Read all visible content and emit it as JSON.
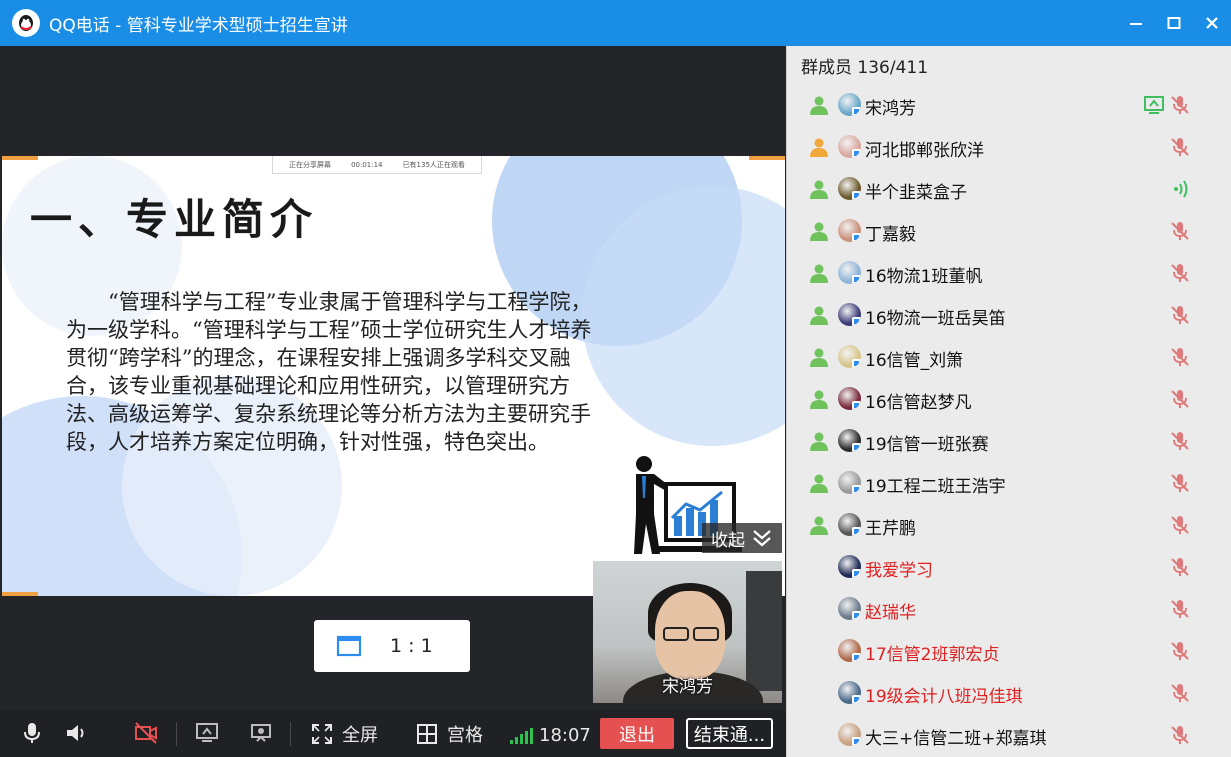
{
  "window": {
    "title": "QQ电话 - 管科专业学术型硕士招生宣讲"
  },
  "slide": {
    "share_bar": [
      "正在分享屏幕",
      "00:01:14",
      "已有135人正在观看"
    ],
    "title": "一、专业简介",
    "body": "“管理科学与工程”专业隶属于管理科学与工程学院，为一级学科。“管理科学与工程”硕士学位研究生人才培养贯彻“跨学科”的理念，在课程安排上强调多学科交叉融合，该专业重视基础理论和应用性研究，以管理研究方法、高级运筹学、复杂系统理论等分析方法为主要研究手段，人才培养方案定位明确，针对性强，特色突出。"
  },
  "collapse_label": "收起",
  "ratio_label": "1 : 1",
  "camera": {
    "name": "宋鸿芳"
  },
  "toolbar": {
    "fullscreen_label": "全屏",
    "grid_label": "宫格",
    "time": "18:07",
    "exit_label": "退出",
    "end_label": "结束通..."
  },
  "members": {
    "header": "群成员 136/411",
    "items": [
      {
        "name": "宋鸿芳",
        "role": "member",
        "status": "muted",
        "sharing": true,
        "red": false,
        "avatar": "#6aa8c8"
      },
      {
        "name": "河北邯郸张欣洋",
        "role": "admin",
        "status": "muted",
        "sharing": false,
        "red": false,
        "avatar": "#d9a7a0"
      },
      {
        "name": "半个韭菜盒子",
        "role": "member",
        "status": "speaking",
        "sharing": false,
        "red": false,
        "avatar": "#6b5a2a"
      },
      {
        "name": "丁嘉毅",
        "role": "member",
        "status": "muted",
        "sharing": false,
        "red": false,
        "avatar": "#c9907a"
      },
      {
        "name": "16物流1班董帆",
        "role": "member",
        "status": "muted",
        "sharing": false,
        "red": false,
        "avatar": "#8fb4d9"
      },
      {
        "name": "16物流一班岳昊笛",
        "role": "member",
        "status": "muted",
        "sharing": false,
        "red": false,
        "avatar": "#3c3c7a"
      },
      {
        "name": "16信管_刘箫",
        "role": "member",
        "status": "muted",
        "sharing": false,
        "red": false,
        "avatar": "#d8c58a"
      },
      {
        "name": "16信管赵梦凡",
        "role": "member",
        "status": "muted",
        "sharing": false,
        "red": false,
        "avatar": "#7a2a3a"
      },
      {
        "name": "19信管一班张赛",
        "role": "member",
        "status": "muted",
        "sharing": false,
        "red": false,
        "avatar": "#2c2c2c"
      },
      {
        "name": "19工程二班王浩宇",
        "role": "member",
        "status": "muted",
        "sharing": false,
        "red": false,
        "avatar": "#9a9a9a"
      },
      {
        "name": "王芹鹏",
        "role": "member",
        "status": "muted",
        "sharing": false,
        "red": false,
        "avatar": "#555555"
      },
      {
        "name": "我爱学习",
        "role": "none",
        "status": "muted",
        "sharing": false,
        "red": true,
        "avatar": "#1d2a55"
      },
      {
        "name": "赵瑞华",
        "role": "none",
        "status": "muted",
        "sharing": false,
        "red": true,
        "avatar": "#6a7a8a"
      },
      {
        "name": "17信管2班郭宏贞",
        "role": "none",
        "status": "muted",
        "sharing": false,
        "red": true,
        "avatar": "#b06a4a"
      },
      {
        "name": "19级会计八班冯佳琪",
        "role": "none",
        "status": "muted",
        "sharing": false,
        "red": true,
        "avatar": "#4a6a8a"
      },
      {
        "name": "大三+信管二班+郑嘉琪",
        "role": "none",
        "status": "muted",
        "sharing": false,
        "red": false,
        "avatar": "#c7a080"
      }
    ]
  },
  "colors": {
    "titlebar": "#1a8ee6",
    "exit": "#e55050",
    "signal": "#2fc04f",
    "member_green": "#6fc25c",
    "admin_orange": "#f2a93b",
    "mute_red": "#e07a7a",
    "red_name": "#e02020"
  }
}
